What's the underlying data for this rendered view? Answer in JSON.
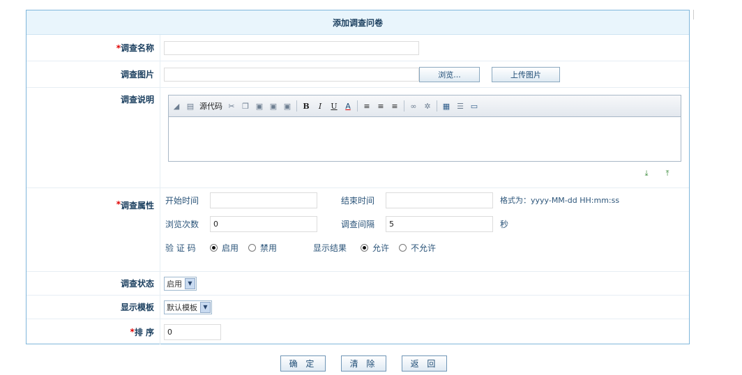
{
  "form_title": "添加调查问卷",
  "required_mark": "*",
  "labels": {
    "name": "调查名称",
    "image": "调查图片",
    "description": "调查说明",
    "properties": "调查属性",
    "status": "调查状态",
    "template": "显示模板",
    "order": "排 序"
  },
  "image_row": {
    "browse_label": "浏览...",
    "upload_label": "上传图片"
  },
  "editor": {
    "source_label": "源代码",
    "toolbar_icons": [
      "cut-icon",
      "copy-icon",
      "paste-icon",
      "paste-text-icon",
      "paste-word-icon",
      "bold-icon",
      "italic-icon",
      "underline-icon",
      "font-color-icon",
      "align-left-icon",
      "align-center-icon",
      "align-right-icon",
      "link-icon",
      "unlink-icon",
      "table-icon",
      "list-icon",
      "maximize-icon"
    ]
  },
  "properties": {
    "start_time_label": "开始时间",
    "start_time_value": "",
    "end_time_label": "结束时间",
    "end_time_value": "",
    "format_hint": "格式为：yyyy-MM-dd HH:mm:ss",
    "views_label": "浏览次数",
    "views_value": "0",
    "interval_label": "调查间隔",
    "interval_value": "5",
    "interval_unit": "秒",
    "captcha_label": "验 证 码",
    "captcha_on": "启用",
    "captcha_off": "禁用",
    "captcha_selected": "启用",
    "result_label": "显示结果",
    "result_allow": "允许",
    "result_deny": "不允许",
    "result_selected": "允许"
  },
  "status_value": "启用",
  "template_value": "默认模板",
  "order_value": "0",
  "buttons": {
    "confirm": "确 定",
    "clear": "清 除",
    "back": "返 回"
  },
  "colors": {
    "border": "#7fb6db",
    "header_bg": "#e9f5fc",
    "label_text": "#1b3f5f",
    "required": "#e00000"
  }
}
